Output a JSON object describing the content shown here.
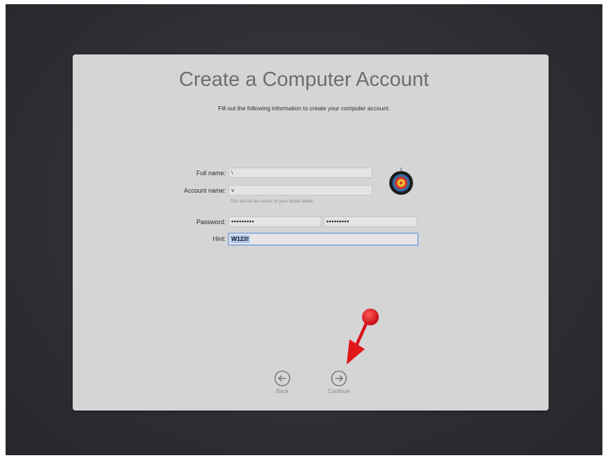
{
  "dialog": {
    "title": "Create a Computer Account",
    "subtitle": "Fill out the following information to create your computer account."
  },
  "form": {
    "full_name": {
      "label": "Full name:",
      "value": "\\"
    },
    "account_name": {
      "label": "Account name:",
      "value": "v",
      "helper": "This will be the name of your home folder."
    },
    "password": {
      "label": "Password:",
      "value": "•••••••••",
      "verify_value": "•••••••••"
    },
    "hint": {
      "label": "Hint:",
      "value": "W123!"
    }
  },
  "navigation": {
    "back_label": "Back",
    "continue_label": "Continue"
  },
  "icons": {
    "avatar": "target-avatar-icon",
    "back": "left-arrow-circle-icon",
    "continue": "right-arrow-circle-icon",
    "annotation": "red-pointer-arrow"
  },
  "colors": {
    "panel": "#d5d5d6",
    "hint_focus": "#8fb0de",
    "annotation_red": "#e0161b"
  }
}
